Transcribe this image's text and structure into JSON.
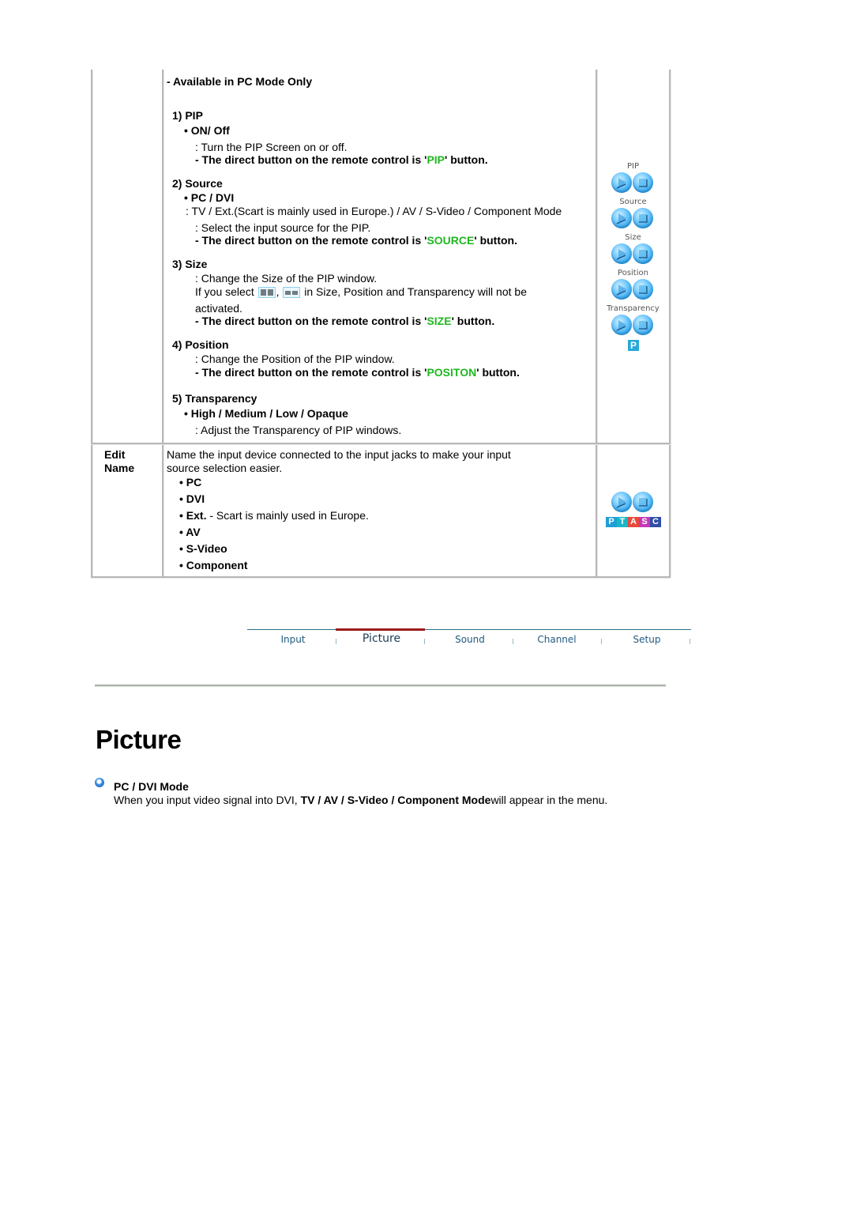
{
  "table": {
    "pip_row": {
      "note": "- Available in PC Mode Only",
      "sections": {
        "pip": {
          "heading": "1) PIP",
          "option": "• ON/ Off",
          "desc": ": Turn the PIP Screen on or off.",
          "remote_prefix": "- The direct button on the remote control is '",
          "remote_key": "PIP",
          "remote_suffix": "' button."
        },
        "source": {
          "heading": "2) Source",
          "option": "• PC / DVI",
          "options_desc": ": TV / Ext.(Scart is mainly used in Europe.) / AV / S-Video / Component Mode",
          "desc": ": Select the input source for the PIP.",
          "remote_prefix": "- The direct button on the remote control is '",
          "remote_key": "SOURCE",
          "remote_suffix": "' button."
        },
        "size": {
          "heading": "3) Size",
          "desc": ": Change the Size of the PIP window.",
          "note_prefix": "If you select",
          "note_comma": ",",
          "note_suffix": "in Size, Position and Transparency will not be",
          "note_cont": "activated.",
          "remote_prefix": "- The direct button on the remote control is '",
          "remote_key": "SIZE",
          "remote_suffix": "' button."
        },
        "position": {
          "heading": "4) Position",
          "desc": ": Change the Position of the PIP window.",
          "remote_prefix": "- The direct button on the remote control is '",
          "remote_key": "POSITON",
          "remote_suffix": "' button."
        },
        "transparency": {
          "heading": "5) Transparency",
          "option": "• High / Medium / Low / Opaque",
          "desc": ": Adjust the Transparency of PIP windows."
        }
      },
      "icon_labels": [
        "PIP",
        "Source",
        "Size",
        "Position",
        "Transparency"
      ],
      "p_badge": "P"
    },
    "edit_name_row": {
      "label_line1": "Edit",
      "label_line2": "Name",
      "desc_line1": "Name the input device connected to the input jacks to make your input",
      "desc_line2": "source selection easier.",
      "items": [
        {
          "bold": "• PC",
          "rest": ""
        },
        {
          "bold": "• DVI",
          "rest": ""
        },
        {
          "bold": "• Ext.",
          "rest": " - Scart is mainly used in Europe."
        },
        {
          "bold": "• AV",
          "rest": ""
        },
        {
          "bold": "• S-Video",
          "rest": ""
        },
        {
          "bold": "• Component",
          "rest": ""
        }
      ],
      "ptasc_letters": [
        "P",
        "T",
        "A",
        "S",
        "C"
      ],
      "ptasc_colors": [
        "#1e9fd6",
        "#19b5c9",
        "#e8493a",
        "#c637b8",
        "#2f4ea8"
      ]
    }
  },
  "nav": {
    "items": [
      "Input",
      "Picture",
      "Sound",
      "Channel",
      "Setup"
    ],
    "active": "Picture",
    "active_color": "#9b1b1b"
  },
  "page": {
    "title": "Picture",
    "section_heading": "PC / DVI Mode",
    "body_prefix": "When you input video signal into DVI, ",
    "body_bold": "TV / AV / S-Video / Component Mode",
    "body_suffix": "will appear in the menu."
  },
  "colors": {
    "remote_key_green": "#1fb81f"
  }
}
